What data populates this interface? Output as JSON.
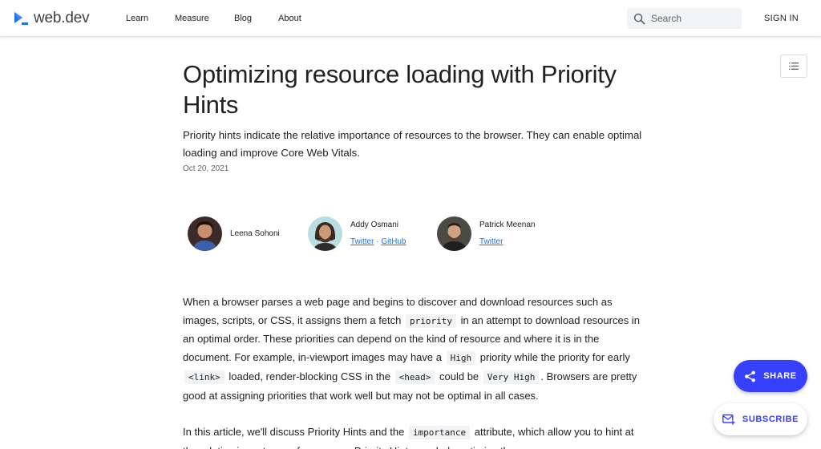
{
  "header": {
    "logo_text": "web.dev",
    "nav": [
      "Learn",
      "Measure",
      "Blog",
      "About"
    ],
    "search_placeholder": "Search",
    "sign_in": "SIGN IN"
  },
  "article": {
    "title": "Optimizing resource loading with Priority Hints",
    "subtitle": "Priority hints indicate the relative importance of resources to the browser. They can enable optimal loading and improve Core Web Vitals.",
    "date": "Oct 20, 2021",
    "authors": [
      {
        "name": "Leena Sohoni",
        "links": []
      },
      {
        "name": "Addy Osmani",
        "links": [
          "Twitter",
          "GitHub"
        ]
      },
      {
        "name": "Patrick Meenan",
        "links": [
          "Twitter"
        ]
      }
    ],
    "link_separator": "·",
    "p1": {
      "t1": "When a browser parses a web page and begins to discover and download resources such as images, scripts, or CSS, it assigns them a fetch",
      "c1": "priority",
      "t2": "in an attempt to download resources in an optimal order. These priorities can depend on the kind of resource and where it is in the document. For example, in-viewport images may have a",
      "c2": "High",
      "t3": "priority while the priority for early",
      "c3": "<link>",
      "t4": "loaded, render-blocking CSS in the",
      "c4": "<head>",
      "t5": "could be",
      "c5": "Very High",
      "t6": ". Browsers are pretty good at assigning priorities that work well but may not be optimal in all cases."
    },
    "p2": {
      "t1": "In this article, we'll discuss Priority Hints and the",
      "c1": "importance",
      "t2": "attribute, which allow you to hint at the relative importance of resources. Priority Hints can help optimize the"
    }
  },
  "fab": {
    "share": "SHARE",
    "subscribe": "SUBSCRIBE"
  },
  "colors": {
    "accent": "#3740ff",
    "link": "#1a73e8",
    "text": "#202124",
    "muted": "#5f6368"
  },
  "icons": [
    "web-dev-logo-icon",
    "search-icon",
    "toc-list-icon",
    "share-icon",
    "subscribe-mail-icon"
  ]
}
